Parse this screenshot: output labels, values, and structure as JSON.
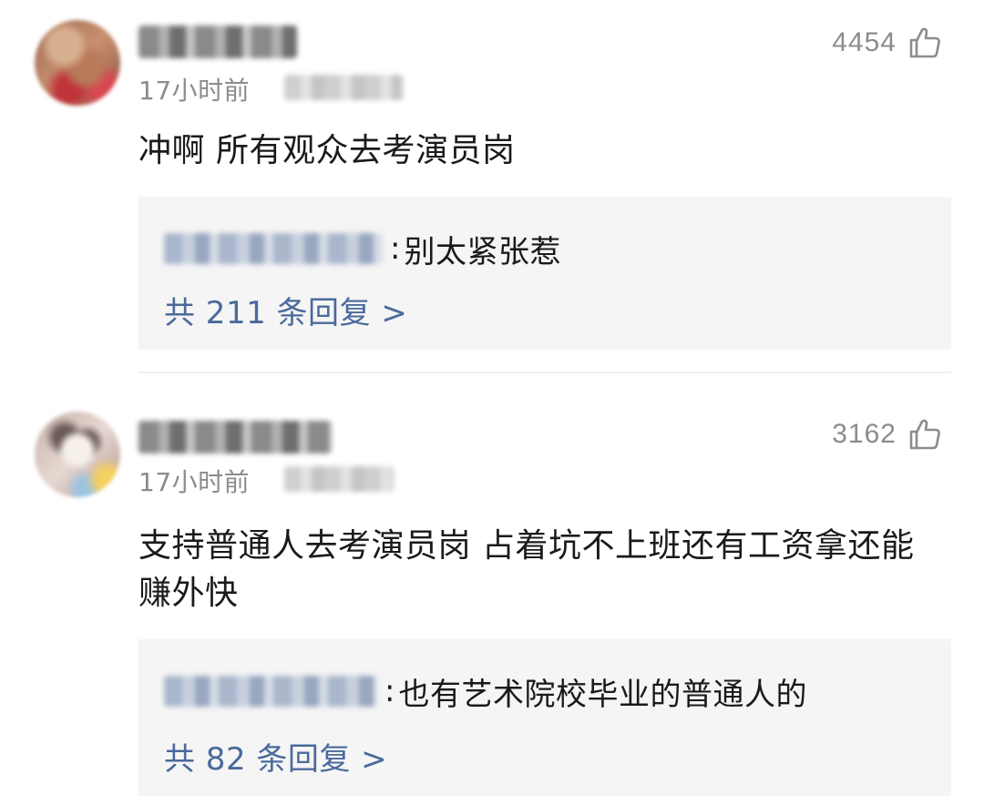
{
  "comments": [
    {
      "time": "17小时前",
      "likes": "4454",
      "content": "冲啊 所有观众去考演员岗",
      "reply": {
        "text": "别太紧张惹",
        "count_label": "共 211 条回复 >"
      }
    },
    {
      "time": "17小时前",
      "likes": "3162",
      "content": "支持普通人去考演员岗 占着坑不上班还有工资拿还能赚外快",
      "reply": {
        "text": "也有艺术院校毕业的普通人的",
        "count_label": "共 82 条回复 >"
      }
    }
  ],
  "colors": {
    "reply_link": "#4a6a9c",
    "meta_gray": "#8c8c8c",
    "reply_bg": "#f5f5f5"
  },
  "icons": {
    "like": "thumbs-up-icon"
  }
}
